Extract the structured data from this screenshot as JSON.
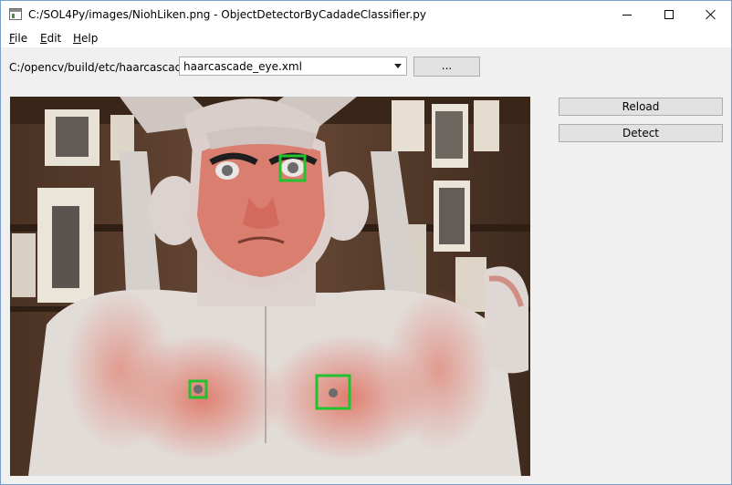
{
  "window": {
    "title": "C:/SOL4Py/images/NiohLiken.png - ObjectDetectorByCadadeClassifier.py"
  },
  "menu": [
    {
      "mnemonic": "F",
      "rest": "ile"
    },
    {
      "mnemonic": "E",
      "rest": "dit"
    },
    {
      "mnemonic": "H",
      "rest": "elp"
    }
  ],
  "toolbar": {
    "cascade_dir": "C:/opencv/build/etc/haarcascades",
    "cascade_file": "haarcascade_eye.xml",
    "browse_label": "..."
  },
  "actions": {
    "reload_label": "Reload",
    "detect_label": "Detect"
  },
  "detections": [
    {
      "label": "eye"
    },
    {
      "label": "eye"
    },
    {
      "label": "eye"
    }
  ],
  "colors": {
    "detection_box": "#22c22e",
    "statue_white": "#e4dfdc",
    "statue_red": "#d9675a",
    "background_wood": "#5a3d2c"
  },
  "icons": {
    "app": "app-window-icon",
    "minimize": "minimize-icon",
    "maximize": "maximize-icon",
    "close": "close-icon",
    "dropdown": "chevron-down-icon"
  }
}
